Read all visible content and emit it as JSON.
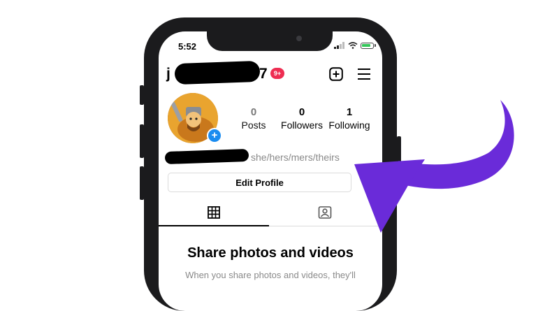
{
  "status_bar": {
    "time": "5:52"
  },
  "profile": {
    "username_start": "j",
    "username_end": "7",
    "notification_badge": "9+",
    "stats": [
      {
        "value": "0",
        "label": "Posts"
      },
      {
        "value": "0",
        "label": "Followers"
      },
      {
        "value": "1",
        "label": "Following"
      }
    ],
    "pronouns": "she/hers/mers/theirs",
    "edit_button_label": "Edit Profile"
  },
  "empty_state": {
    "title": "Share photos and videos",
    "body": "When you share photos and videos, they'll"
  },
  "colors": {
    "arrow": "#6a2bd9",
    "badge": "#ee2d52",
    "add_avatar": "#1a8cf0",
    "battery": "#34c759"
  },
  "icons": {
    "signal": "signal-icon",
    "wifi": "wifi-icon",
    "battery": "battery-icon",
    "new_post": "plus-square-icon",
    "menu": "hamburger-menu-icon",
    "grid_tab": "grid-icon",
    "tagged_tab": "tagged-person-icon"
  }
}
